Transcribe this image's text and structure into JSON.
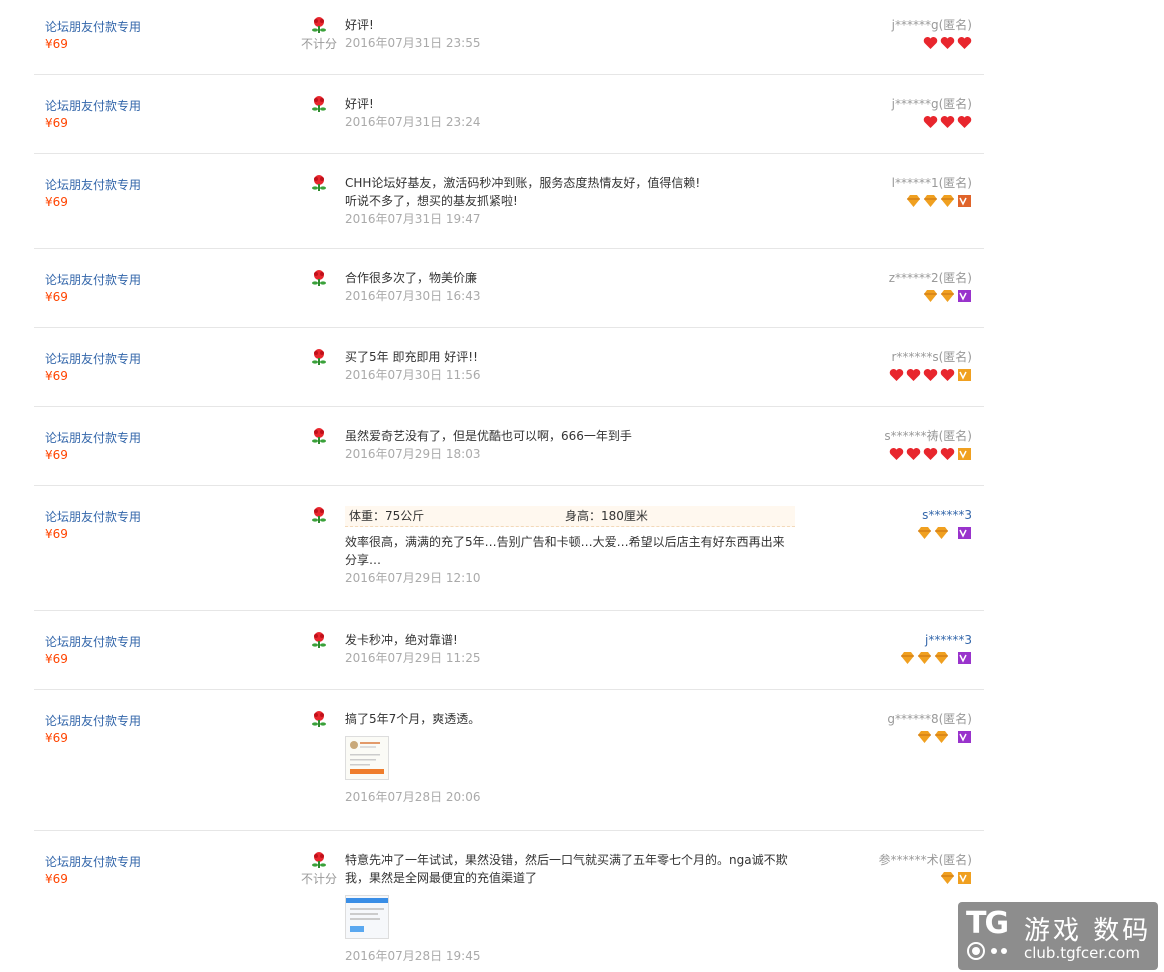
{
  "colors": {
    "link": "#3366aa",
    "price": "#ff4400",
    "date": "#aaaaaa",
    "divider": "#e6e6e6",
    "heart": "#e8262d",
    "diamond": "#f0a020",
    "vip": "#9933cc",
    "crown": "#e0642a"
  },
  "reviews": [
    {
      "item_name": "论坛朋友付款专用",
      "price": "¥69",
      "no_count": "不计分",
      "text": "好评!",
      "date": "2016年07月31日 23:55",
      "user": "j******g(匿名)",
      "badges": [
        "heart-icon",
        "heart-icon",
        "heart-icon"
      ]
    },
    {
      "item_name": "论坛朋友付款专用",
      "price": "¥69",
      "text": "好评!",
      "date": "2016年07月31日 23:24",
      "user": "j******g(匿名)",
      "badges": [
        "heart-icon",
        "heart-icon",
        "heart-icon"
      ]
    },
    {
      "item_name": "论坛朋友付款专用",
      "price": "¥69",
      "text": "CHH论坛好基友，激活码秒冲到账，服务态度热情友好，值得信赖!",
      "text2": "听说不多了，想买的基友抓紧啦!",
      "date": "2016年07月31日 19:47",
      "user": "l******1(匿名)",
      "badges": [
        "diamond-icon",
        "diamond-icon",
        "diamond-icon",
        "crown-vip-icon"
      ]
    },
    {
      "item_name": "论坛朋友付款专用",
      "price": "¥69",
      "text": "合作很多次了，物美价廉",
      "date": "2016年07月30日 16:43",
      "user": "z******2(匿名)",
      "badges": [
        "diamond-icon",
        "diamond-icon",
        "vip-icon"
      ]
    },
    {
      "item_name": "论坛朋友付款专用",
      "price": "¥69",
      "text": "买了5年 即充即用 好评!!",
      "date": "2016年07月30日 11:56",
      "user": "r******s(匿名)",
      "badges": [
        "heart-icon",
        "heart-icon",
        "heart-icon",
        "heart-icon",
        "gold-vip-icon"
      ]
    },
    {
      "item_name": "论坛朋友付款专用",
      "price": "¥69",
      "text": "虽然爱奇艺没有了，但是优酷也可以啊，666一年到手",
      "date": "2016年07月29日 18:03",
      "user": "s******祷(匿名)",
      "badges": [
        "heart-icon",
        "heart-icon",
        "heart-icon",
        "heart-icon",
        "gold-vip-icon"
      ]
    },
    {
      "item_name": "论坛朋友付款专用",
      "price": "¥69",
      "attr1": "体重：75公斤",
      "attr2": "身高：180厘米",
      "text": "效率很高，满满的充了5年…告别广告和卡顿…大爱…希望以后店主有好东西再出来",
      "text2": "分享…",
      "date": "2016年07月29日 12:10",
      "user": "s******3",
      "badges": [
        "diamond-icon",
        "diamond-icon",
        "vip-icon"
      ]
    },
    {
      "item_name": "论坛朋友付款专用",
      "price": "¥69",
      "text": "发卡秒冲，绝对靠谱!",
      "date": "2016年07月29日 11:25",
      "user": "j******3",
      "badges": [
        "diamond-icon",
        "diamond-icon",
        "diamond-icon",
        "vip-icon"
      ]
    },
    {
      "item_name": "论坛朋友付款专用",
      "price": "¥69",
      "text": "搞了5年7个月，爽透透。",
      "date": "2016年07月28日 20:06",
      "user": "g******8(匿名)",
      "badges": [
        "diamond-icon",
        "diamond-icon",
        "vip-icon"
      ]
    },
    {
      "item_name": "论坛朋友付款专用",
      "price": "¥69",
      "no_count": "不计分",
      "text": "特意先冲了一年试试，果然没错，然后一口气就买满了五年零七个月的。nga诚不欺",
      "text2": "我，果然是全网最便宜的充值渠道了",
      "date": "2016年07月28日 19:45",
      "user": "参******术(匿名)",
      "badges": [
        "diamond-icon",
        "crown-vip-icon"
      ]
    }
  ],
  "watermark": {
    "logo": "TG",
    "title": "游戏 数码",
    "url": "club.tgfcer.com"
  }
}
